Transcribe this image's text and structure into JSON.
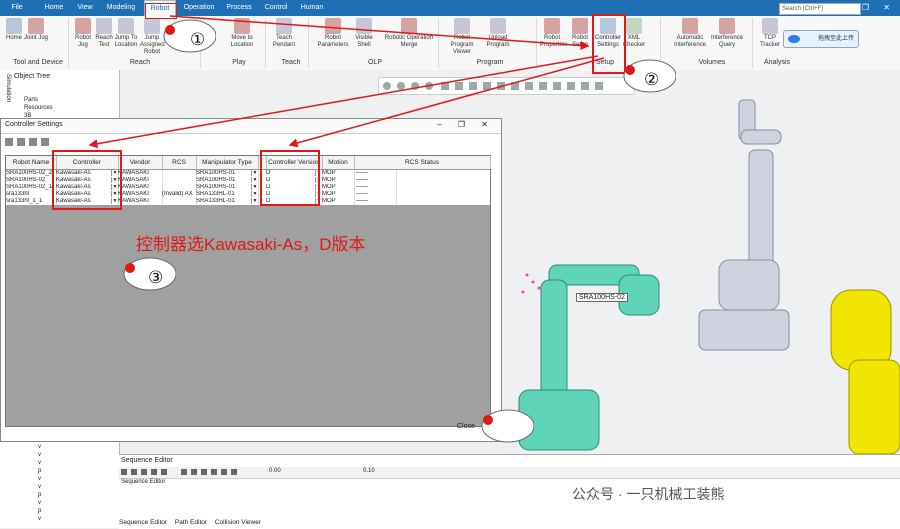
{
  "tabs": [
    "File",
    "Home",
    "View",
    "Modeling",
    "Robot",
    "Operation",
    "Process",
    "Control",
    "Human"
  ],
  "active_tab": "Robot",
  "search_placeholder": "Search (Ctrl+F)",
  "window_controls": "– ❐ ✕",
  "cloud_button": "拖拽至此上传",
  "ribbon_buttons": [
    "Home",
    "Joint Jog",
    "Robot Jog",
    "Reach Test",
    "Jump To Location",
    "Jump Assigned Robot",
    "Move to Location",
    "Teach Pendant",
    "Robot Parameters",
    "Visible Shell",
    "Robotic Operation Merge",
    "Robot Program Viewer",
    "Upload Program",
    "Robot Properties",
    "Robot Setup",
    "Controller Settings",
    "XML Checker",
    "Automatic Interference",
    "Interference Query",
    "TCP Tracker"
  ],
  "ribbon_groups": [
    "Tool and Device",
    "Reach",
    "Play",
    "Teach",
    "OLP",
    "Program",
    "Setup",
    "Volumes",
    "Analysis"
  ],
  "side_strip": "Simulation",
  "object_tree": {
    "title": "Object Tree",
    "items": [
      "Parts",
      "Resources",
      "3B"
    ]
  },
  "dialog": {
    "title": "Controller Settings",
    "columns": [
      "Robot Name",
      "Controller",
      "Vendor",
      "RCS Version",
      "Manipulator Type",
      "",
      "Controller Version",
      "Motion Planner",
      "RCS Status"
    ],
    "rows": [
      [
        "SRA100HS-02_2",
        "Kawasaki-As",
        "KAWASAKI",
        "",
        "SRA100HS-01",
        "",
        "D",
        "MOP",
        "——"
      ],
      [
        "SRA100HS-02",
        "Kawasaki-As",
        "KAWASAKI",
        "",
        "SRA100HS-01",
        "",
        "D",
        "MOP",
        "——"
      ],
      [
        "SRA100HS-02_1",
        "Kawasaki-As",
        "KAWASAKI",
        "",
        "SRA100HS-01",
        "",
        "D",
        "MOP",
        "——"
      ],
      [
        "sra133hl",
        "Kawasaki-As",
        "KAWASAKI",
        "(Invalid) AX",
        "SRA133HL-01",
        "",
        "D",
        "MOP",
        "——"
      ],
      [
        "sra133hl_1_1",
        "Kawasaki-As",
        "KAWASAKI",
        "",
        "SRA133HL-01",
        "",
        "D",
        "MOP",
        "——"
      ]
    ],
    "close_label": "Close"
  },
  "annotation": "控制器选Kawasaki-As，D版本",
  "step_numbers": [
    "①",
    "②",
    "③"
  ],
  "robot_label": "SRA100HS-02",
  "sequence_editor": {
    "title": "Sequence Editor",
    "subtitle": "Sequence Editor",
    "time_left": "0.00",
    "time_step": "0.10",
    "tabs": [
      "Sequence Editor",
      "Path Editor",
      "Collision Viewer"
    ]
  },
  "tree_bottom_rows": [
    "v",
    "v",
    "v",
    "p",
    "v",
    "v",
    "p",
    "v",
    "p",
    "v",
    "p",
    "v",
    "p"
  ],
  "watermark": "公众号 · 一只机械工装熊",
  "colors": {
    "ribbon": "#1f6fb5",
    "annotation": "#e01818",
    "robot_teal": "#5fd4b8",
    "robot_yellow": "#f2e600",
    "robot_gray": "#cfd3e0"
  }
}
